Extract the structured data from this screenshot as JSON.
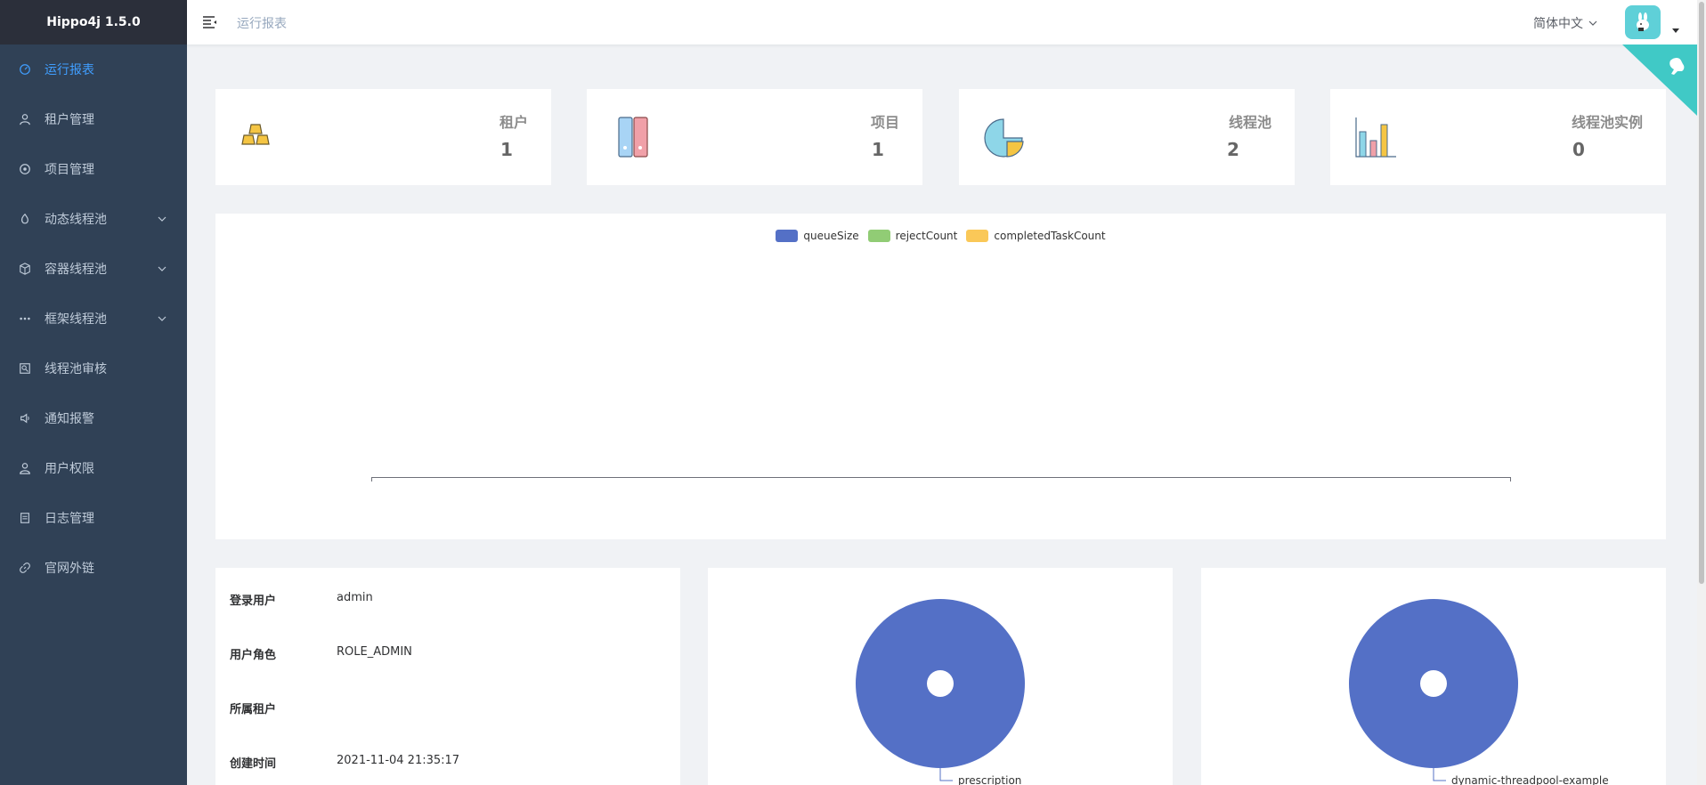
{
  "app": {
    "title": "Hippo4j 1.5.0"
  },
  "sidebar": {
    "items": [
      {
        "label": "运行报表",
        "icon": "dashboard-icon",
        "active": true,
        "expandable": false
      },
      {
        "label": "租户管理",
        "icon": "user-icon",
        "active": false,
        "expandable": false
      },
      {
        "label": "项目管理",
        "icon": "project-icon",
        "active": false,
        "expandable": false
      },
      {
        "label": "动态线程池",
        "icon": "fire-icon",
        "active": false,
        "expandable": true
      },
      {
        "label": "容器线程池",
        "icon": "box-icon",
        "active": false,
        "expandable": true
      },
      {
        "label": "框架线程池",
        "icon": "more-icon",
        "active": false,
        "expandable": true
      },
      {
        "label": "线程池审核",
        "icon": "audit-icon",
        "active": false,
        "expandable": false
      },
      {
        "label": "通知报警",
        "icon": "bell-icon",
        "active": false,
        "expandable": false
      },
      {
        "label": "用户权限",
        "icon": "permission-icon",
        "active": false,
        "expandable": false
      },
      {
        "label": "日志管理",
        "icon": "log-icon",
        "active": false,
        "expandable": false
      },
      {
        "label": "官网外链",
        "icon": "link-icon",
        "active": false,
        "expandable": false
      }
    ]
  },
  "navbar": {
    "breadcrumb": "运行报表",
    "language": "简体中文"
  },
  "stats": [
    {
      "title": "租户",
      "value": "1",
      "icon": "gold-bars-icon"
    },
    {
      "title": "项目",
      "value": "1",
      "icon": "books-icon"
    },
    {
      "title": "线程池",
      "value": "2",
      "icon": "pie-chart-icon"
    },
    {
      "title": "线程池实例",
      "value": "0",
      "icon": "bar-chart-icon"
    }
  ],
  "chart_data": [
    {
      "type": "line",
      "series": [
        {
          "name": "queueSize",
          "values": []
        },
        {
          "name": "rejectCount",
          "values": []
        },
        {
          "name": "completedTaskCount",
          "values": []
        }
      ],
      "colors": [
        "#5470c6",
        "#91cc75",
        "#fac858"
      ],
      "legend": "top-center",
      "grid": false
    },
    {
      "type": "pie",
      "categories": [
        "prescription"
      ],
      "values": [
        1
      ],
      "colors": [
        "#5470c6"
      ]
    },
    {
      "type": "pie",
      "categories": [
        "dynamic-threadpool-example"
      ],
      "values": [
        1
      ],
      "colors": [
        "#5470c6"
      ]
    }
  ],
  "user_info": {
    "rows": [
      {
        "label": "登录用户",
        "value": "admin"
      },
      {
        "label": "用户角色",
        "value": "ROLE_ADMIN"
      },
      {
        "label": "所属租户",
        "value": ""
      },
      {
        "label": "创建时间",
        "value": "2021-11-04 21:35:17"
      }
    ]
  },
  "colors": {
    "sidebar_bg": "#304156",
    "logo_bg": "#2b2f3a",
    "accent": "#409eff",
    "corner": "#40c9c6"
  }
}
